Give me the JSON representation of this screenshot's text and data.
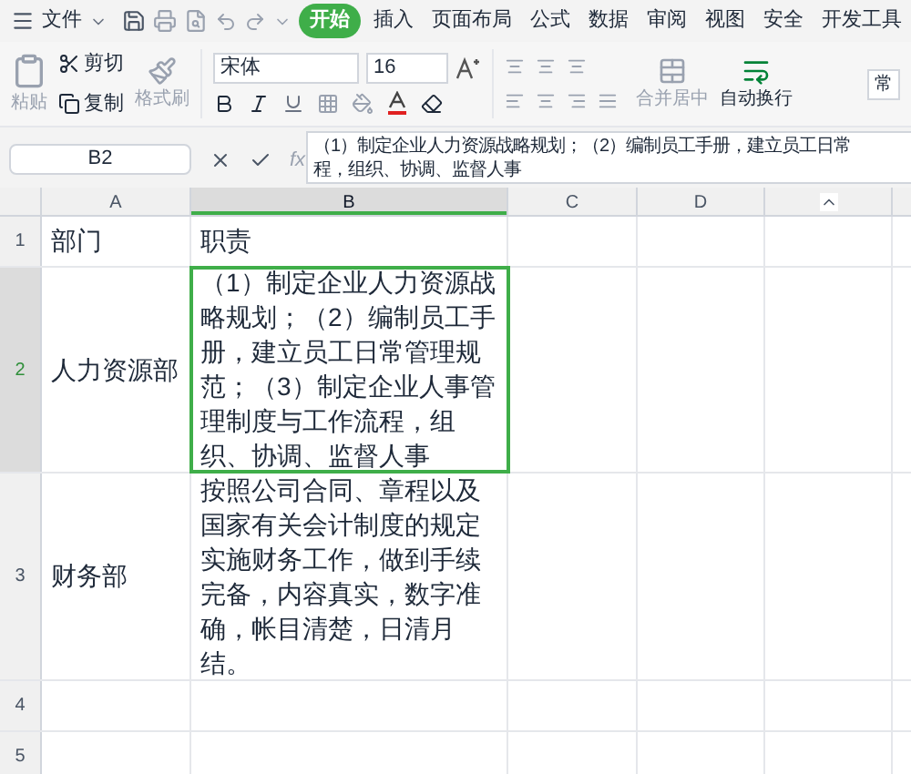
{
  "menu": {
    "file": "文件",
    "tabs": [
      {
        "label": "开始",
        "selected": true
      },
      {
        "label": "插入",
        "selected": false
      },
      {
        "label": "页面布局",
        "selected": false
      },
      {
        "label": "公式",
        "selected": false
      },
      {
        "label": "数据",
        "selected": false
      },
      {
        "label": "审阅",
        "selected": false
      },
      {
        "label": "视图",
        "selected": false
      },
      {
        "label": "安全",
        "selected": false
      },
      {
        "label": "开发工具",
        "selected": false
      }
    ]
  },
  "toolbar": {
    "paste": "粘贴",
    "cut": "剪切",
    "copy": "复制",
    "format_painter": "格式刷",
    "font": "宋体",
    "font_size": "16",
    "merge": "合并居中",
    "wrap": "自动换行",
    "number_format": "常"
  },
  "formula_bar": {
    "cell_ref": "B2",
    "fx": "fx",
    "lines": [
      "（1）制定企业人力资源战略规划；（2）编制员工手册，建立员工日常",
      "程，组织、协调、监督人事"
    ]
  },
  "columns": [
    {
      "label": "A",
      "selected": false
    },
    {
      "label": "B",
      "selected": true
    },
    {
      "label": "C",
      "selected": false
    },
    {
      "label": "D",
      "selected": false
    }
  ],
  "rows": [
    {
      "number": "1",
      "selected": false,
      "cells": [
        "部门",
        "职责"
      ]
    },
    {
      "number": "2",
      "selected": true,
      "cells": [
        "人力资源部",
        "（1）制定企业人力资源战略规划；（2）编制员工手册，建立员工日常管理规范；（3）制定企业人事管理制度与工作流程，组织、协调、监督人事"
      ]
    },
    {
      "number": "3",
      "selected": false,
      "cells": [
        "财务部",
        "按照公司合同、章程以及国家有关会计制度的规定实施财务工作，做到手续完备，内容真实，数字准确，帐目清楚，日清月结。"
      ]
    },
    {
      "number": "4",
      "selected": false,
      "cells": []
    },
    {
      "number": "5",
      "selected": false,
      "cells": []
    }
  ]
}
